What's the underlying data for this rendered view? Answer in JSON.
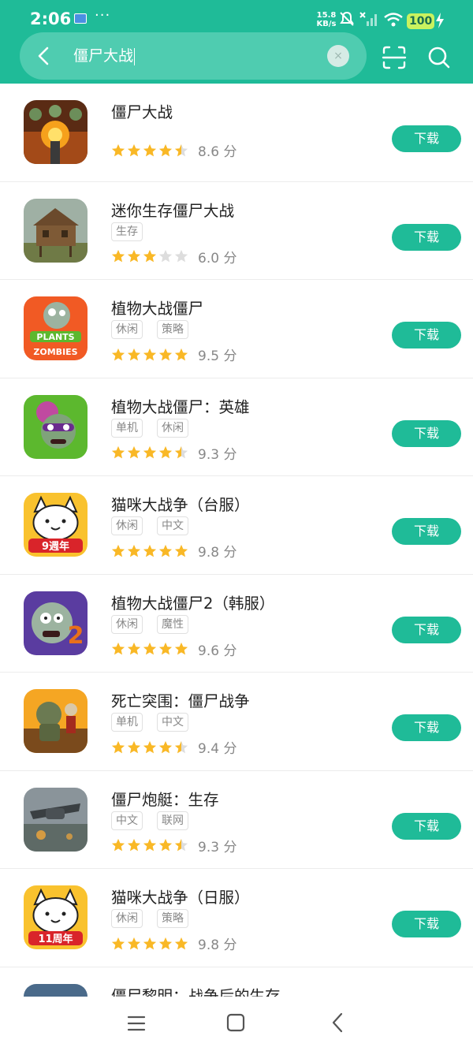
{
  "status_bar": {
    "time": "2:06",
    "dots": "···",
    "net_speed_value": "15.8",
    "net_speed_unit": "KB/s",
    "battery": "100"
  },
  "search": {
    "query": "僵尸大战",
    "clear_symbol": "×"
  },
  "download_label": "下载",
  "score_suffix": "分",
  "results": [
    {
      "name": "僵尸大战",
      "tags": [],
      "stars": 4.5,
      "score": "8.6",
      "icon": "zombie-shooter-icon"
    },
    {
      "name": "迷你生存僵尸大战",
      "tags": [
        "生存"
      ],
      "stars": 3,
      "score": "6.0",
      "icon": "wooden-house-icon"
    },
    {
      "name": "植物大战僵尸",
      "tags": [
        "休闲",
        "策略"
      ],
      "stars": 5,
      "score": "9.5",
      "icon": "plants-vs-zombies-icon"
    },
    {
      "name": "植物大战僵尸：英雄",
      "tags": [
        "单机",
        "休闲"
      ],
      "stars": 4.5,
      "score": "9.3",
      "icon": "pvz-heroes-icon"
    },
    {
      "name": "猫咪大战争（台服）",
      "tags": [
        "休闲",
        "中文"
      ],
      "stars": 5,
      "score": "9.8",
      "icon": "battle-cats-tw-icon",
      "badge": "9週年"
    },
    {
      "name": "植物大战僵尸2（韩服）",
      "tags": [
        "休闲",
        "魔性"
      ],
      "stars": 5,
      "score": "9.6",
      "icon": "pvz2-zombie-icon"
    },
    {
      "name": "死亡突围：僵尸战争",
      "tags": [
        "单机",
        "中文"
      ],
      "stars": 4.5,
      "score": "9.4",
      "icon": "dead-ahead-icon"
    },
    {
      "name": "僵尸炮艇：生存",
      "tags": [
        "中文",
        "联网"
      ],
      "stars": 4.5,
      "score": "9.3",
      "icon": "gunship-icon"
    },
    {
      "name": "猫咪大战争（日服）",
      "tags": [
        "休闲",
        "策略"
      ],
      "stars": 5,
      "score": "9.8",
      "icon": "battle-cats-jp-icon",
      "badge": "11周年"
    },
    {
      "name": "僵尸黎明：战争后的生存",
      "tags": [],
      "stars": 0,
      "score": "",
      "icon": "zombie-dawn-icon"
    }
  ],
  "colors": {
    "accent": "#1fbb98",
    "star_on": "#f9b826",
    "star_off": "#dddddd"
  }
}
